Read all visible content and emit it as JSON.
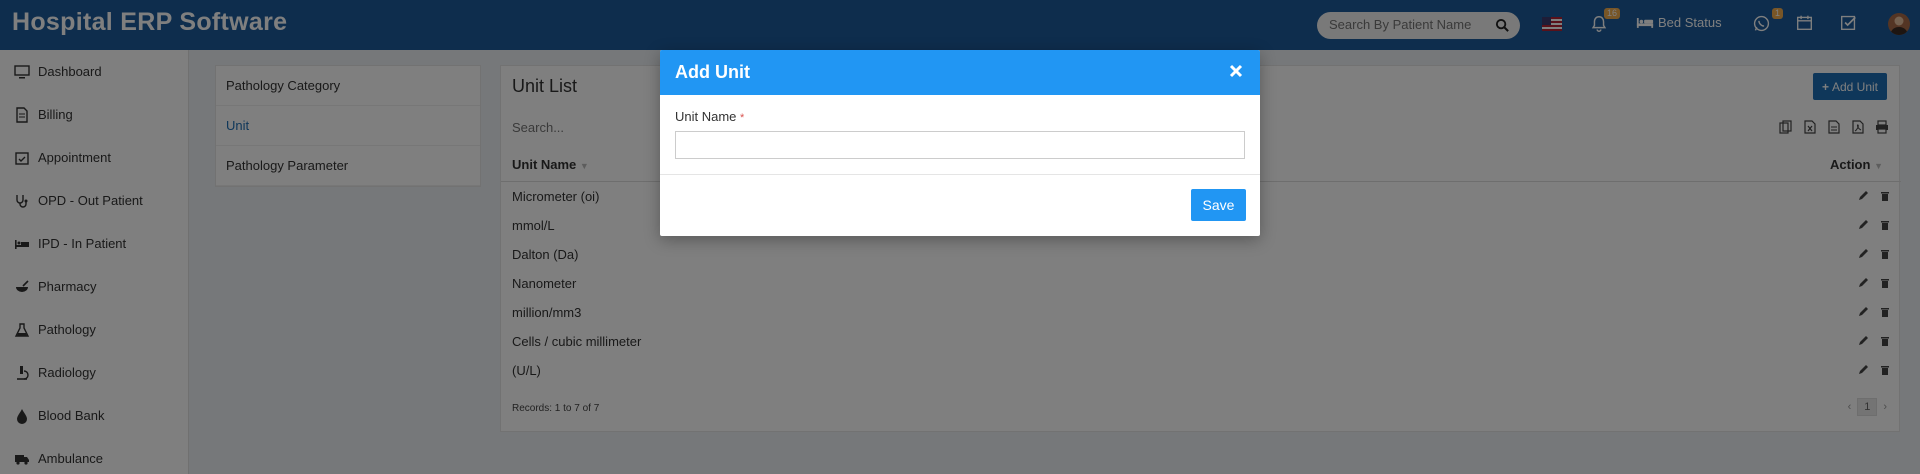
{
  "app": {
    "title": "Hospital ERP Software"
  },
  "header": {
    "search_placeholder": "Search By Patient Name",
    "notifications_count": "16",
    "whatsapp_count": "1",
    "bed_status_label": "Bed Status"
  },
  "sidebar": {
    "items": [
      {
        "label": "Dashboard",
        "icon": "monitor-icon"
      },
      {
        "label": "Billing",
        "icon": "file-icon"
      },
      {
        "label": "Appointment",
        "icon": "calendar-check-icon"
      },
      {
        "label": "OPD - Out Patient",
        "icon": "stethoscope-icon"
      },
      {
        "label": "IPD - In Patient",
        "icon": "bed-icon"
      },
      {
        "label": "Pharmacy",
        "icon": "mortar-icon"
      },
      {
        "label": "Pathology",
        "icon": "flask-icon"
      },
      {
        "label": "Radiology",
        "icon": "microscope-icon"
      },
      {
        "label": "Blood Bank",
        "icon": "drop-icon"
      },
      {
        "label": "Ambulance",
        "icon": "ambulance-icon"
      }
    ]
  },
  "submenu": {
    "items": [
      {
        "label": "Pathology Category"
      },
      {
        "label": "Unit"
      },
      {
        "label": "Pathology Parameter"
      }
    ],
    "active_index": 1
  },
  "panel": {
    "title": "Unit List",
    "add_label": "Add Unit",
    "search_placeholder": "Search...",
    "columns": {
      "name": "Unit Name",
      "action": "Action"
    },
    "rows": [
      "Micrometer (oi)",
      "mmol/L",
      "Dalton (Da)",
      "Nanometer",
      "million/mm3",
      "Cells / cubic millimeter",
      "(U/L)"
    ],
    "records_text": "Records: 1 to 7 of 7",
    "pager": {
      "current": "1",
      "prev": "‹",
      "next": "›"
    }
  },
  "modal": {
    "title": "Add Unit",
    "close": "×",
    "field_label": "Unit Name",
    "required_mark": "*",
    "field_value": "",
    "save_label": "Save"
  },
  "colors": {
    "header_bg": "#1d5b9a",
    "modal_header": "#2196f3",
    "accent": "#1e6fb5"
  }
}
